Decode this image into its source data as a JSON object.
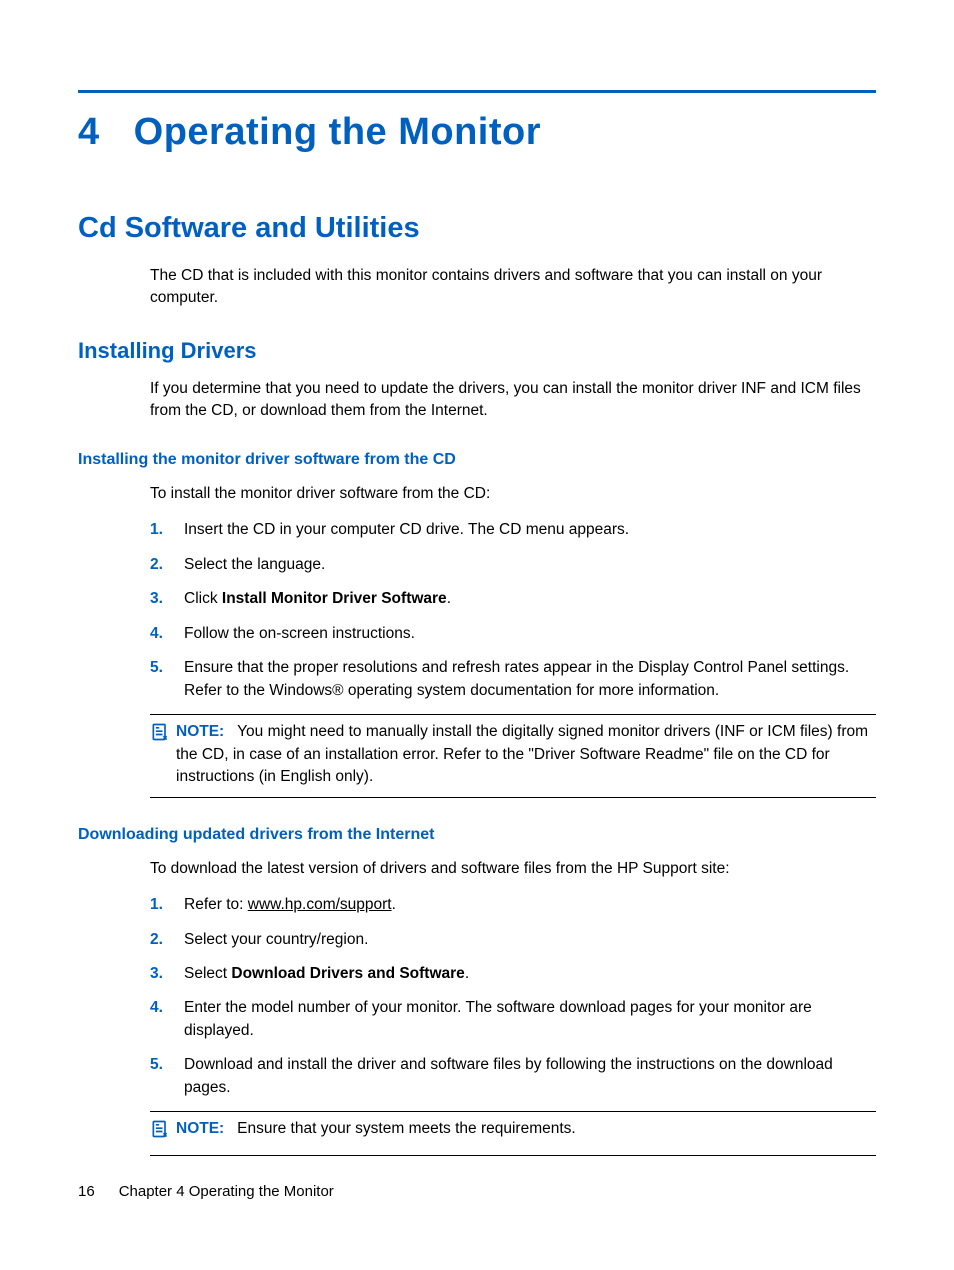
{
  "chapter": {
    "number": "4",
    "title": "Operating the Monitor"
  },
  "section1": {
    "title": "Cd Software and Utilities",
    "intro": "The CD that is included with this monitor contains drivers and software that you can install on your computer."
  },
  "sub1": {
    "title": "Installing Drivers",
    "intro": "If you determine that you need to update the drivers, you can install the monitor driver INF and ICM files from the CD, or download them from the Internet."
  },
  "subsub1": {
    "title": "Installing the monitor driver software from the CD",
    "intro": "To install the monitor driver software from the CD:",
    "steps": [
      {
        "num": "1.",
        "text": "Insert the CD in your computer CD drive. The CD menu appears."
      },
      {
        "num": "2.",
        "text": "Select the language."
      },
      {
        "num": "3.",
        "prefix": "Click ",
        "bold": "Install Monitor Driver Software",
        "suffix": "."
      },
      {
        "num": "4.",
        "text": "Follow the on-screen instructions."
      },
      {
        "num": "5.",
        "text": "Ensure that the proper resolutions and refresh rates appear in the Display Control Panel settings. Refer to the Windows® operating system documentation for more information."
      }
    ],
    "note": {
      "label": "NOTE:",
      "text": "You might need to manually install the digitally signed monitor drivers (INF or ICM files) from the CD, in case of an installation error. Refer to the \"Driver Software Readme\" file on the CD for instructions (in English only)."
    }
  },
  "subsub2": {
    "title": "Downloading updated drivers from the Internet",
    "intro": "To download the latest version of drivers and software files from the HP Support site:",
    "steps": [
      {
        "num": "1.",
        "prefix": "Refer to: ",
        "link": "www.hp.com/support",
        "suffix": "."
      },
      {
        "num": "2.",
        "text": "Select your country/region."
      },
      {
        "num": "3.",
        "prefix": "Select ",
        "bold": "Download Drivers and Software",
        "suffix": "."
      },
      {
        "num": "4.",
        "text": "Enter the model number of your monitor. The software download pages for your monitor are displayed."
      },
      {
        "num": "5.",
        "text": "Download and install the driver and software files by following the instructions on the download pages."
      }
    ],
    "note": {
      "label": "NOTE:",
      "text": "Ensure that your system meets the requirements."
    }
  },
  "footer": {
    "page": "16",
    "chapterref": "Chapter 4   Operating the Monitor"
  }
}
